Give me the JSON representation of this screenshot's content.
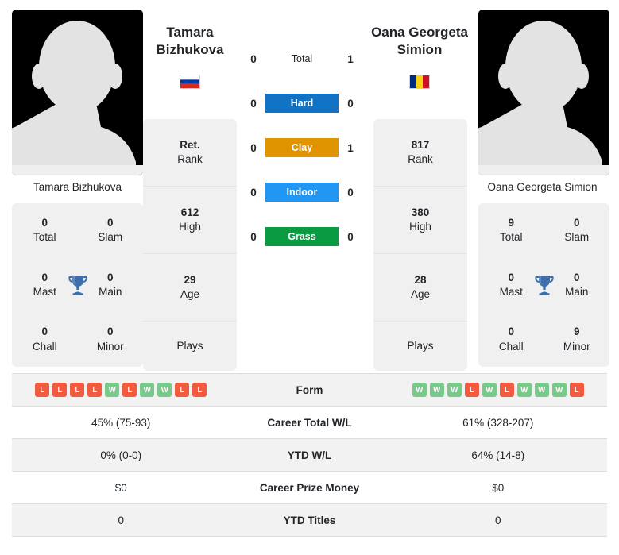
{
  "players": {
    "left": {
      "name": "Tamara Bizhukova",
      "name_line1": "Tamara",
      "name_line2": "Bizhukova",
      "country": "Russia",
      "flag_colors": [
        "#ffffff",
        "#0039a6",
        "#d52b1e"
      ],
      "flag_orientation": "horizontal",
      "rank": "Ret.",
      "rank_label": "Rank",
      "high": "612",
      "high_label": "High",
      "age": "29",
      "age_label": "Age",
      "plays": "",
      "plays_label": "Plays",
      "titles": {
        "total": "0",
        "total_label": "Total",
        "slam": "0",
        "slam_label": "Slam",
        "mast": "0",
        "mast_label": "Mast",
        "main": "0",
        "main_label": "Main",
        "chall": "0",
        "chall_label": "Chall",
        "minor": "0",
        "minor_label": "Minor"
      },
      "h2h": {
        "total": "0",
        "hard": "0",
        "clay": "0",
        "indoor": "0",
        "grass": "0"
      },
      "form": [
        "L",
        "L",
        "L",
        "L",
        "W",
        "L",
        "W",
        "W",
        "L",
        "L"
      ],
      "career_total_wl": "45% (75-93)",
      "ytd_wl": "0% (0-0)",
      "career_prize_money": "$0",
      "ytd_titles": "0"
    },
    "right": {
      "name": "Oana Georgeta Simion",
      "name_line1": "Oana Georgeta",
      "name_line2": "Simion",
      "country": "Romania",
      "flag_colors": [
        "#002b7f",
        "#fcd116",
        "#ce1126"
      ],
      "flag_orientation": "vertical",
      "rank": "817",
      "rank_label": "Rank",
      "high": "380",
      "high_label": "High",
      "age": "28",
      "age_label": "Age",
      "plays": "",
      "plays_label": "Plays",
      "titles": {
        "total": "9",
        "total_label": "Total",
        "slam": "0",
        "slam_label": "Slam",
        "mast": "0",
        "mast_label": "Mast",
        "main": "0",
        "main_label": "Main",
        "chall": "0",
        "chall_label": "Chall",
        "minor": "9",
        "minor_label": "Minor"
      },
      "h2h": {
        "total": "1",
        "hard": "0",
        "clay": "1",
        "indoor": "0",
        "grass": "0"
      },
      "form": [
        "W",
        "W",
        "W",
        "L",
        "W",
        "L",
        "W",
        "W",
        "W",
        "L"
      ],
      "career_total_wl": "61% (328-207)",
      "ytd_wl": "64% (14-8)",
      "career_prize_money": "$0",
      "ytd_titles": "0"
    }
  },
  "surfaces": [
    {
      "key": "total",
      "label": "Total",
      "color": "transparent",
      "text_color": "#212529"
    },
    {
      "key": "hard",
      "label": "Hard",
      "color": "#1273c4",
      "text_color": "#ffffff"
    },
    {
      "key": "clay",
      "label": "Clay",
      "color": "#e09400",
      "text_color": "#ffffff"
    },
    {
      "key": "indoor",
      "label": "Indoor",
      "color": "#2196f3",
      "text_color": "#ffffff"
    },
    {
      "key": "grass",
      "label": "Grass",
      "color": "#0a9b42",
      "text_color": "#ffffff"
    }
  ],
  "stats_rows": [
    {
      "label": "Form",
      "key": "form",
      "type": "form"
    },
    {
      "label": "Career Total W/L",
      "key": "career_total_wl",
      "type": "text"
    },
    {
      "label": "YTD W/L",
      "key": "ytd_wl",
      "type": "text"
    },
    {
      "label": "Career Prize Money",
      "key": "career_prize_money",
      "type": "text"
    },
    {
      "label": "YTD Titles",
      "key": "ytd_titles",
      "type": "text"
    }
  ],
  "colors": {
    "win_badge": "#79c98b",
    "loss_badge": "#f15b40",
    "panel_bg": "#f0f0f0",
    "row_alt_bg": "#f2f2f2",
    "trophy": "#3d6fad"
  },
  "icons": {
    "trophy": "trophy-icon",
    "avatar": "player-avatar-placeholder"
  }
}
